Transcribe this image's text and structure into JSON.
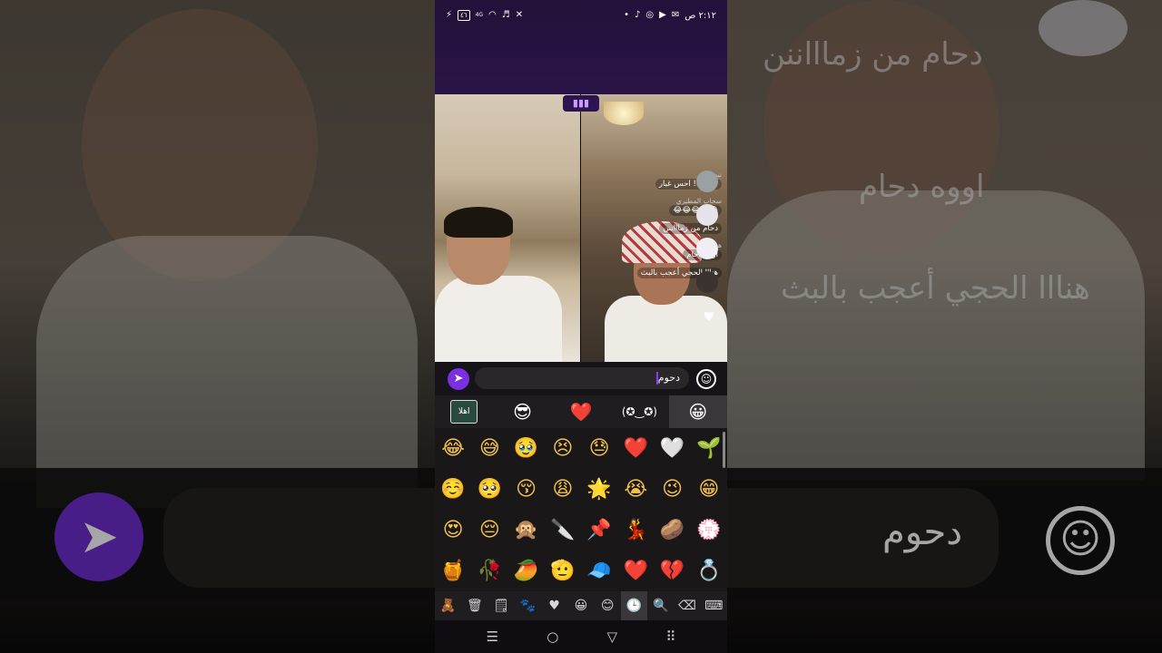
{
  "status_bar": {
    "time": "٢:١٢ ص",
    "battery": "٤٦",
    "network": "4G"
  },
  "stream": {
    "live_icon": "audio-bars-icon",
    "chat": [
      {
        "name": "نيم الغل",
        "text": "@ديمه! احس غبار"
      },
      {
        "name": "سحاب المطيري",
        "text": "😂😂😂😂😂"
      },
      {
        "name": "",
        "text": "دحام من زماااننن"
      },
      {
        "name": "هنوف",
        "text": "اووه دحام"
      },
      {
        "name": "",
        "text": "هنااا الحجي أعجب بالبث"
      }
    ]
  },
  "input": {
    "value": "دحوم",
    "send_icon": "send-icon",
    "emoji_icon": "smile-icon"
  },
  "emoji_tabs": [
    "😀",
    "(✪‿✪)",
    "❤️",
    "😎",
    "اهلا"
  ],
  "emoji_grid": [
    "😂",
    "😅",
    "🥹",
    "😣",
    "😓",
    "❤️",
    "🤍",
    "🌱",
    "☺️",
    "🥺",
    "😚",
    "😩",
    "🌟",
    "😭",
    "😉",
    "😁",
    "😍",
    "😔",
    "🙊",
    "🔪",
    "📌",
    "💃",
    "🥔",
    "💮",
    "🍯",
    "🥀",
    "🥭",
    "🫡",
    "🧢",
    "❤️",
    "💔",
    "💍"
  ],
  "emoji_bottom": [
    "⌨",
    "⌫",
    "🔍",
    "🕒",
    "😊",
    "😀",
    "♥",
    "🐾",
    "🗒",
    "🗑",
    "🧸"
  ],
  "navbar": [
    "⠿",
    "▽",
    "○",
    "☰"
  ]
}
